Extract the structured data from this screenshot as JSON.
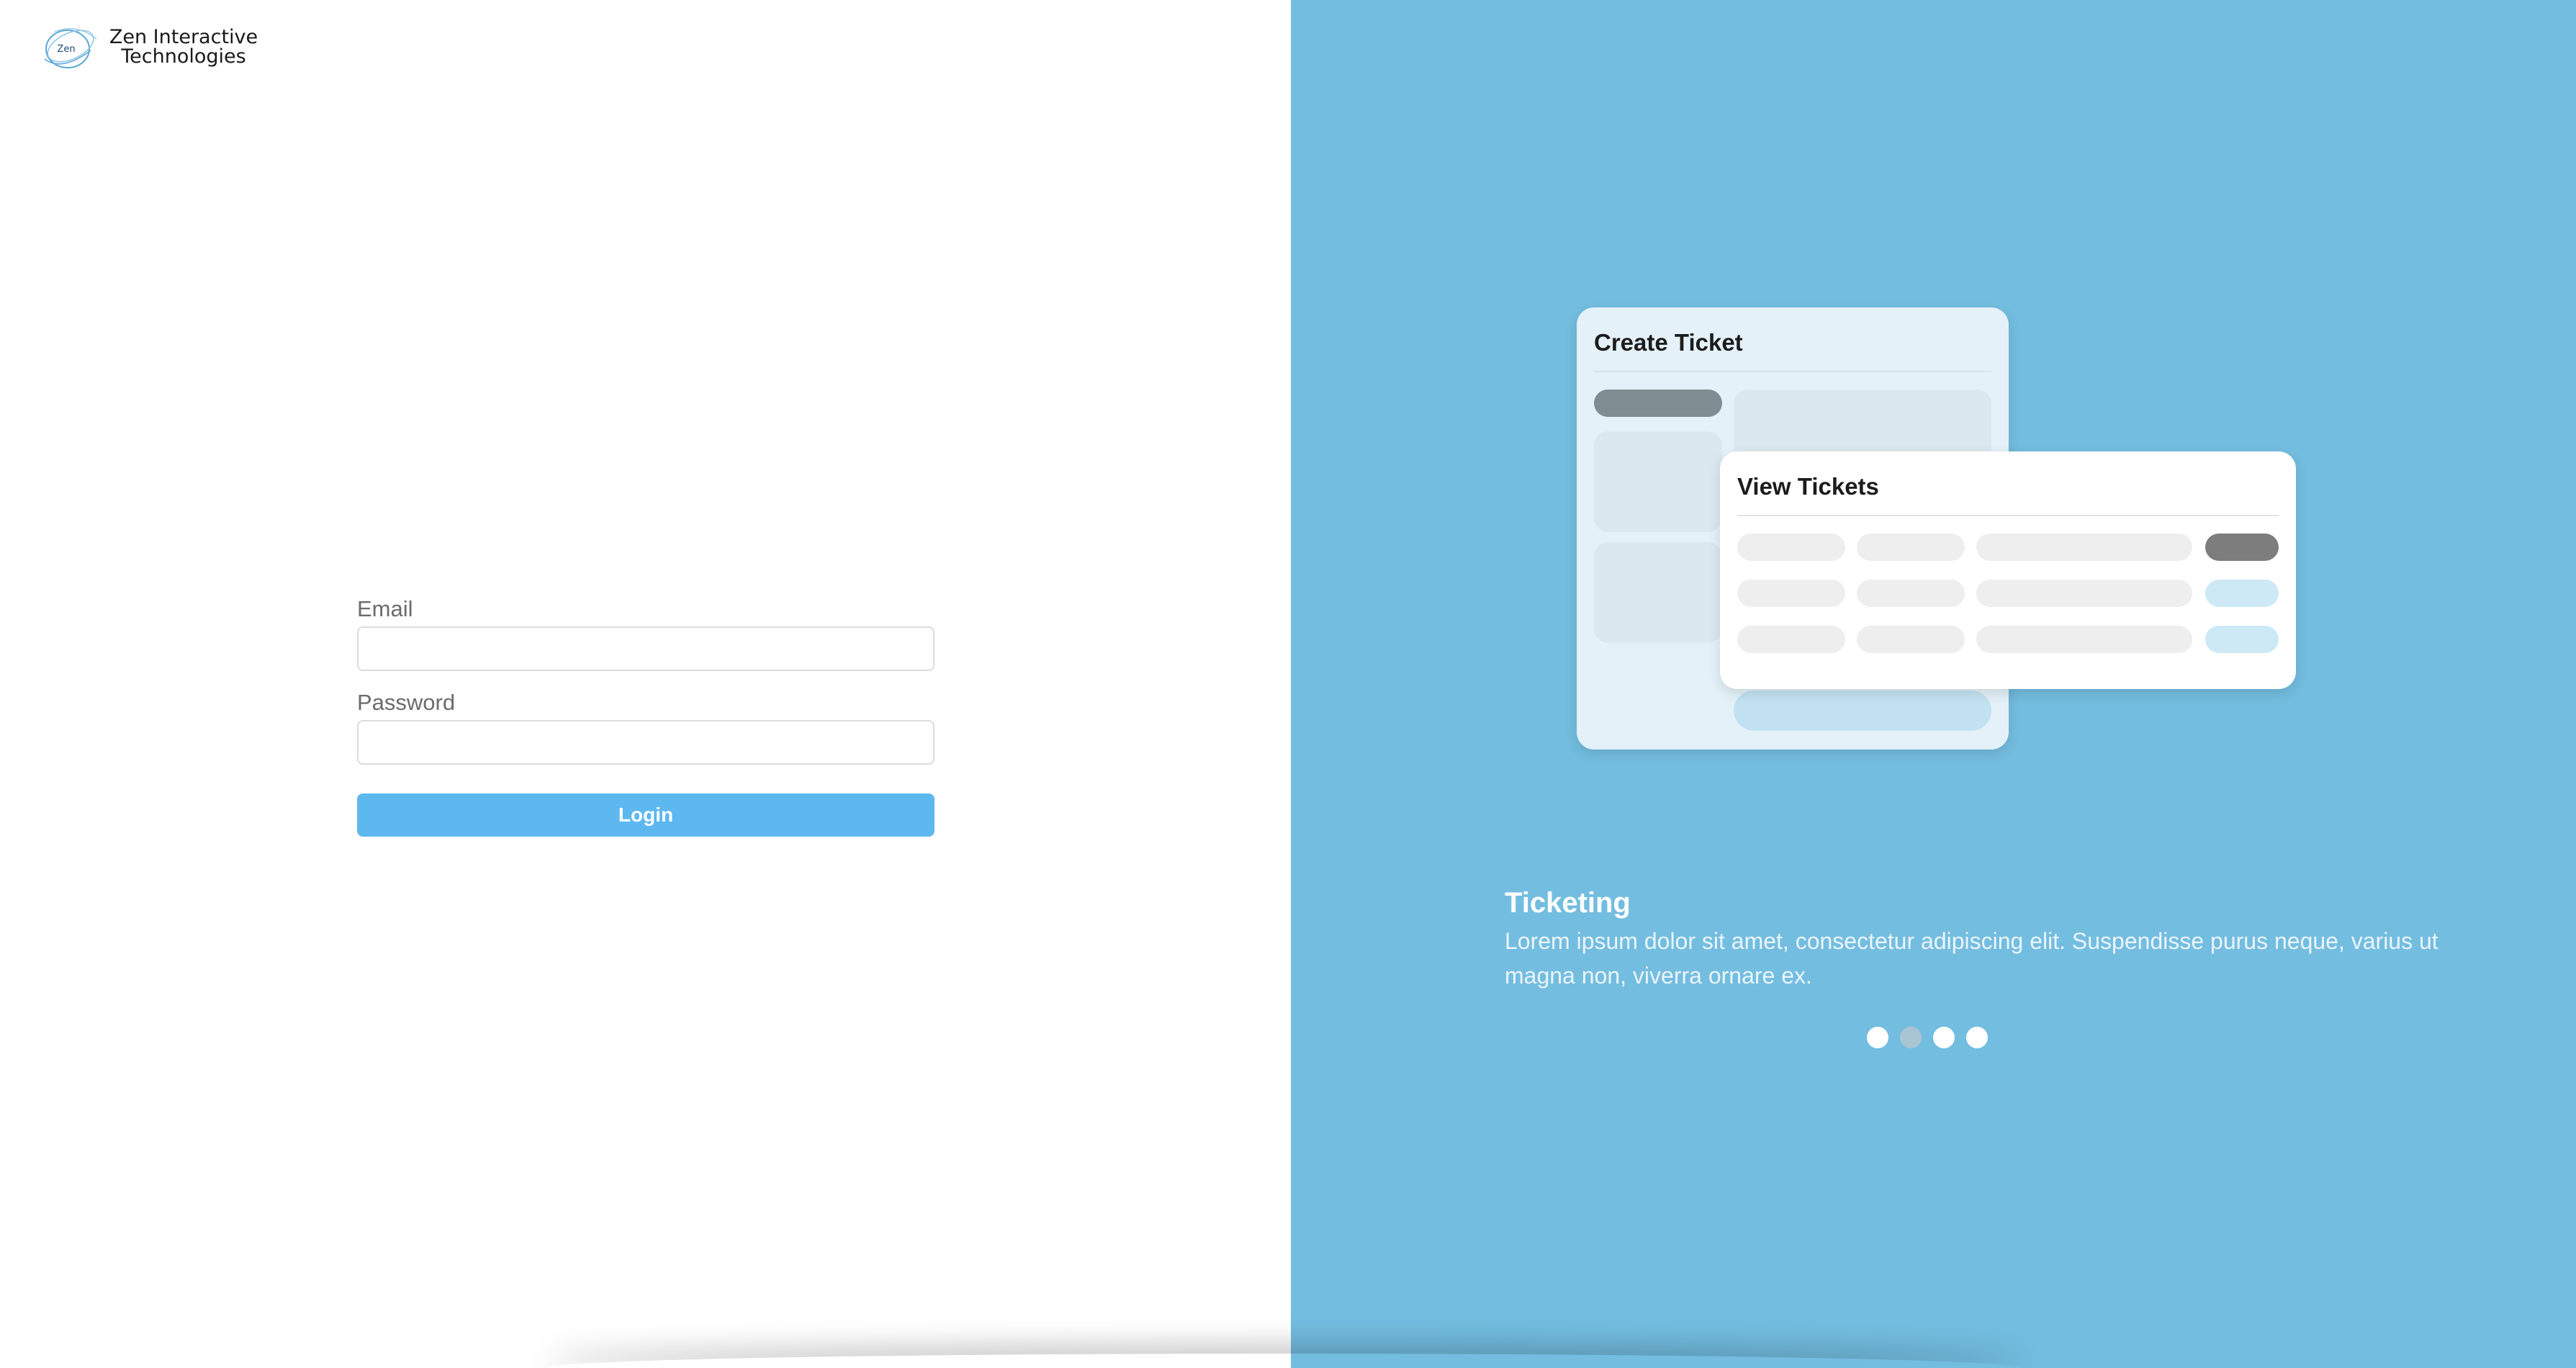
{
  "brand": {
    "logo_text": "Zen",
    "name_line1": "Zen Interactive",
    "name_line2": "Technologies",
    "logo_icon": "zen-swirl-logo"
  },
  "login": {
    "email_label": "Email",
    "email_value": "",
    "password_label": "Password",
    "password_value": "",
    "button_label": "Login"
  },
  "carousel": {
    "illustration": {
      "create_card_title": "Create Ticket",
      "view_card_title": "View Tickets"
    },
    "slide_title": "Ticketing",
    "slide_body": "Lorem ipsum dolor sit amet, consectetur adipiscing elit. Suspendisse purus neque, varius ut magna non, viverra ornare ex.",
    "total_slides": 4,
    "active_slide": 2
  },
  "colors": {
    "accent": "#5eb8f0",
    "right_panel_bg": "#73bde0",
    "dot_active": "#ffffff",
    "dot_inactive": "#a9c4d2"
  }
}
